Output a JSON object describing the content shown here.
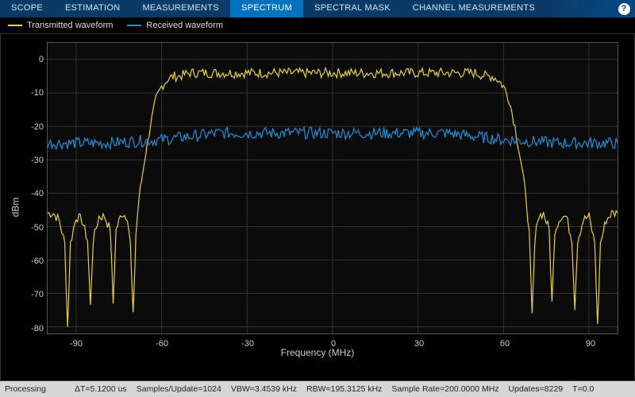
{
  "tabs": {
    "items": [
      "SCOPE",
      "ESTIMATION",
      "MEASUREMENTS",
      "SPECTRUM",
      "SPECTRAL MASK",
      "CHANNEL MEASUREMENTS"
    ],
    "active_index": 3
  },
  "help_glyph": "?",
  "legend": {
    "items": [
      {
        "label": "Transmitted waveform",
        "color": "#e6d23a"
      },
      {
        "label": "Received waveform",
        "color": "#1f8fd6"
      }
    ]
  },
  "axes": {
    "xlabel": "Frequency (MHz)",
    "ylabel": "dBm"
  },
  "status": {
    "processing": "Processing",
    "dt": "ΔT=5.1200 us",
    "spu": "Samples/Update=1024",
    "vbw": "VBW=3.4539 kHz",
    "rbw": "RBW=195.3125 kHz",
    "rate": "Sample Rate=200.0000 MHz",
    "updates": "Updates=8229",
    "t": "T=0.0"
  },
  "chart_data": {
    "type": "line",
    "title": "",
    "xlabel": "Frequency (MHz)",
    "ylabel": "dBm",
    "xlim": [
      -100,
      100
    ],
    "ylim": [
      -82,
      5
    ],
    "xticks": [
      -90,
      -60,
      -30,
      0,
      30,
      60,
      90
    ],
    "yticks": [
      0,
      -10,
      -20,
      -30,
      -40,
      -50,
      -60,
      -70,
      -80
    ],
    "grid": true,
    "legend_position": "top",
    "series": [
      {
        "name": "Transmitted waveform",
        "color": "#e6d23a",
        "noise_amp": 1.5,
        "x": [
          -100,
          -98,
          -96,
          -94,
          -93,
          -92,
          -90,
          -88,
          -86,
          -85,
          -84,
          -82,
          -80,
          -78,
          -77,
          -76,
          -74,
          -72,
          -71,
          -70,
          -69,
          -68,
          -66,
          -64,
          -62,
          -60,
          -58,
          -56,
          -54,
          -50,
          -40,
          -30,
          -20,
          -10,
          0,
          10,
          20,
          30,
          40,
          50,
          54,
          56,
          58,
          60,
          62,
          64,
          66,
          68,
          69,
          70,
          71,
          72,
          74,
          76,
          77,
          78,
          80,
          82,
          84,
          85,
          86,
          88,
          90,
          92,
          93,
          94,
          96,
          98,
          100
        ],
        "y": [
          -46,
          -46,
          -48,
          -55,
          -80,
          -55,
          -47,
          -48,
          -54,
          -74,
          -54,
          -47,
          -47,
          -51,
          -73,
          -51,
          -46,
          -47,
          -55,
          -77,
          -52,
          -42,
          -30,
          -20,
          -12,
          -8,
          -6,
          -5,
          -5,
          -4,
          -4,
          -4,
          -4,
          -4,
          -4,
          -4,
          -4,
          -4,
          -4,
          -4,
          -5,
          -5,
          -6,
          -8,
          -12,
          -20,
          -30,
          -42,
          -52,
          -77,
          -55,
          -47,
          -46,
          -51,
          -73,
          -51,
          -47,
          -47,
          -54,
          -74,
          -54,
          -48,
          -47,
          -55,
          -80,
          -55,
          -48,
          -46,
          -46
        ]
      },
      {
        "name": "Received waveform",
        "color": "#1f8fd6",
        "noise_amp": 1.8,
        "x": [
          -100,
          -80,
          -60,
          -40,
          -20,
          0,
          20,
          40,
          60,
          80,
          100
        ],
        "y": [
          -25,
          -25,
          -24,
          -22,
          -22,
          -22,
          -22,
          -22,
          -24,
          -25,
          -25
        ]
      }
    ]
  }
}
